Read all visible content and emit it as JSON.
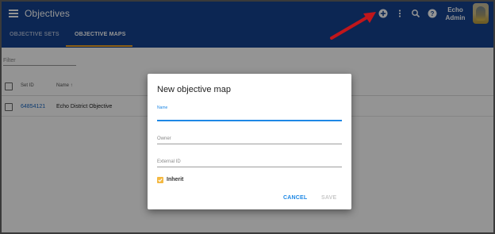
{
  "app": {
    "title": "Objectives"
  },
  "tabs": [
    {
      "label": "OBJECTIVE SETS",
      "active": false
    },
    {
      "label": "OBJECTIVE MAPS",
      "active": true
    }
  ],
  "header_icons": [
    "add-circle-icon",
    "more-vert-icon",
    "search-icon",
    "help-icon"
  ],
  "user": {
    "name_line1": "Echo",
    "name_line2": "Admin"
  },
  "filter": {
    "placeholder": "Filter"
  },
  "table": {
    "columns": [
      "Set ID",
      "Name ↑"
    ],
    "rows": [
      {
        "set_id": "64854121",
        "name": "Echo District Objective"
      }
    ]
  },
  "dialog": {
    "title": "New objective map",
    "fields": {
      "name_label": "Name",
      "owner_label": "Owner",
      "external_id_label": "External ID"
    },
    "inherit_label": "Inherit",
    "inherit_checked": true,
    "cancel_label": "CANCEL",
    "save_label": "SAVE"
  },
  "colors": {
    "appbar": "#16438f",
    "accent": "#f5a623",
    "primary": "#1e88e5",
    "annotation_arrow": "#c0161b"
  }
}
